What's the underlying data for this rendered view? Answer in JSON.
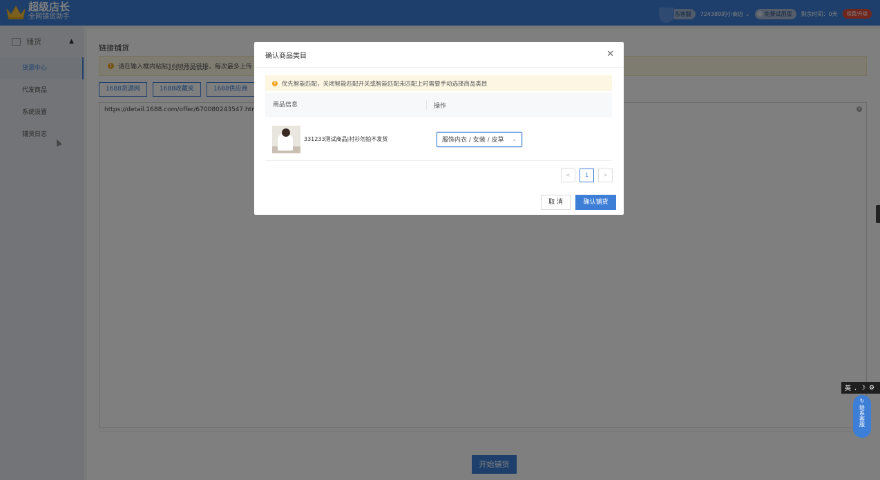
{
  "header": {
    "logo_title": "超级店长",
    "logo_sub": "全网铺货助手",
    "customer_service": "东客服",
    "shop_name": "724389的小商店",
    "trial_label": "免费试用版",
    "remaining_time": "剩余时间：0天",
    "renew_label": "续费/升级",
    "brand_color": "#3d7ed6"
  },
  "sidebar": {
    "group_label": "铺货",
    "items": [
      {
        "label": "货源中心",
        "active": true
      },
      {
        "label": "代发商品",
        "active": false
      },
      {
        "label": "系统设置",
        "active": false
      },
      {
        "label": "铺货日志",
        "active": false
      }
    ]
  },
  "main": {
    "section_title": "链接铺货",
    "warning_prefix": "请在输入框内粘贴",
    "warning_link": "1688商品链接",
    "warning_suffix": "，每次最多上传",
    "source_buttons": [
      "1688货源网",
      "1688收藏夹",
      "1688供应商"
    ],
    "textarea_value": "https://detail.1688.com/offer/670080243547.htm",
    "start_button": "开始铺货"
  },
  "modal": {
    "title": "确认商品类目",
    "notice": "优先智能匹配，关闭智能匹配开关或智能匹配未匹配上时需要手动选择商品类目",
    "col_info": "商品信息",
    "col_action": "操作",
    "rows": [
      {
        "name": "331233测试商品|衬衫勿拍不发货",
        "category": "服饰内衣 / 女装 / 皮草"
      }
    ],
    "pager": {
      "prev": "<",
      "current": "1",
      "next": ">"
    },
    "cancel": "取 消",
    "confirm": "确认铺货"
  },
  "widgets": {
    "ime_label": "英",
    "contact_label": "联系客服"
  }
}
